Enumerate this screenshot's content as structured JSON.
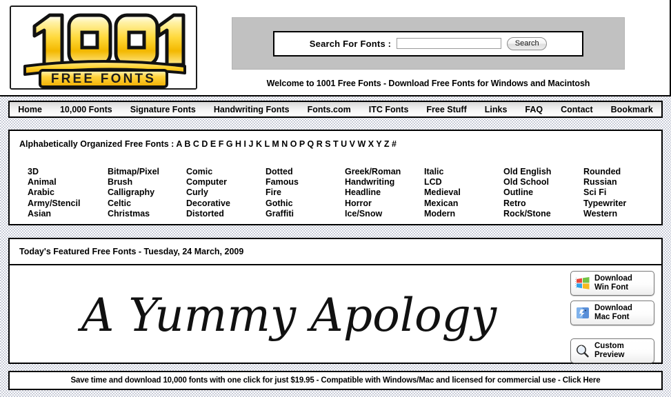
{
  "site": {
    "logo_line1": "1001",
    "logo_line2": "FREE FONTS"
  },
  "search": {
    "label": "Search For Fonts :",
    "value": "",
    "placeholder": "",
    "button_label": "Search"
  },
  "welcome": "Welcome to 1001 Free Fonts - Download Free Fonts for Windows and Macintosh",
  "nav": {
    "items": [
      {
        "label": "Home"
      },
      {
        "label": "10,000 Fonts"
      },
      {
        "label": "Signature Fonts"
      },
      {
        "label": "Handwriting Fonts"
      },
      {
        "label": "Fonts.com"
      },
      {
        "label": "ITC Fonts"
      },
      {
        "label": "Free Stuff"
      },
      {
        "label": "Links"
      },
      {
        "label": "FAQ"
      },
      {
        "label": "Contact"
      },
      {
        "label": "Bookmark"
      }
    ]
  },
  "alphabetical": {
    "label": "Alphabetically Organized Free Fonts :",
    "letters": [
      "A",
      "B",
      "C",
      "D",
      "E",
      "F",
      "G",
      "H",
      "I",
      "J",
      "K",
      "L",
      "M",
      "N",
      "O",
      "P",
      "Q",
      "R",
      "S",
      "T",
      "U",
      "V",
      "W",
      "X",
      "Y",
      "Z",
      "#"
    ]
  },
  "categories": {
    "columns": [
      [
        "3D",
        "Animal",
        "Arabic",
        "Army/Stencil",
        "Asian"
      ],
      [
        "Bitmap/Pixel",
        "Brush",
        "Calligraphy",
        "Celtic",
        "Christmas"
      ],
      [
        "Comic",
        "Computer",
        "Curly",
        "Decorative",
        "Distorted"
      ],
      [
        "Dotted",
        "Famous",
        "Fire",
        "Gothic",
        "Graffiti"
      ],
      [
        "Greek/Roman",
        "Handwriting",
        "Headline",
        "Horror",
        "Ice/Snow"
      ],
      [
        "Italic",
        "LCD",
        "Medieval",
        "Mexican",
        "Modern"
      ],
      [
        "Old English",
        "Old School",
        "Outline",
        "Retro",
        "Rock/Stone"
      ],
      [
        "Rounded",
        "Russian",
        "Sci Fi",
        "Typewriter",
        "Western"
      ]
    ]
  },
  "featured": {
    "title": "Today's Featured Free Fonts - Tuesday, 24 March, 2009",
    "sample_text": "A Yummy Apology",
    "actions": [
      {
        "label": "Download\nWin Font",
        "icon": "windows-logo-icon"
      },
      {
        "label": "Download\nMac Font",
        "icon": "mac-finder-icon"
      },
      {
        "label": "Custom\nPreview",
        "icon": "magnifier-icon"
      }
    ]
  },
  "footer": {
    "text": "Save time and download 10,000 fonts with one click for just $19.95 - Compatible with Windows/Mac and licensed for commercial use - Click Here"
  },
  "colors": {
    "logo_gold": "#F5C518",
    "logo_gold_light": "#FFF08A",
    "search_panel_gray": "#C1C1C1",
    "border_black": "#000000",
    "page_bg": "#FFFFFF"
  }
}
